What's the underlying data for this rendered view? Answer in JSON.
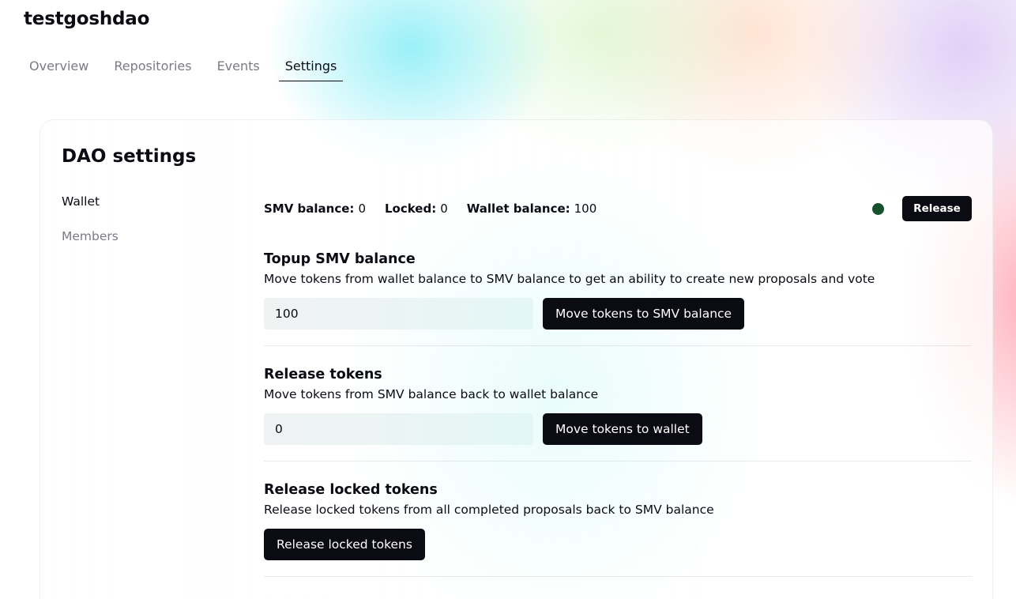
{
  "dao": {
    "name": "testgoshdao"
  },
  "tabs": [
    {
      "label": "Overview",
      "active": false
    },
    {
      "label": "Repositories",
      "active": false
    },
    {
      "label": "Events",
      "active": false
    },
    {
      "label": "Settings",
      "active": true
    }
  ],
  "settings": {
    "title": "DAO settings",
    "nav": [
      {
        "label": "Wallet",
        "active": true
      },
      {
        "label": "Members",
        "active": false
      }
    ],
    "balances": {
      "smv_label": "SMV balance:",
      "smv_value": "0",
      "locked_label": "Locked:",
      "locked_value": "0",
      "wallet_label": "Wallet balance:",
      "wallet_value": "100",
      "status_color": "#16502d",
      "release_label": "Release"
    },
    "topup": {
      "title": "Topup SMV balance",
      "description": "Move tokens from wallet balance to SMV balance to get an ability to create new proposals and vote",
      "value": "100",
      "button": "Move tokens to SMV balance"
    },
    "release": {
      "title": "Release tokens",
      "description": "Move tokens from SMV balance back to wallet balance",
      "value": "0",
      "button": "Move tokens to wallet"
    },
    "release_locked": {
      "title": "Release locked tokens",
      "description": "Release locked tokens from all completed proposals back to SMV balance",
      "button": "Release locked tokens"
    }
  }
}
